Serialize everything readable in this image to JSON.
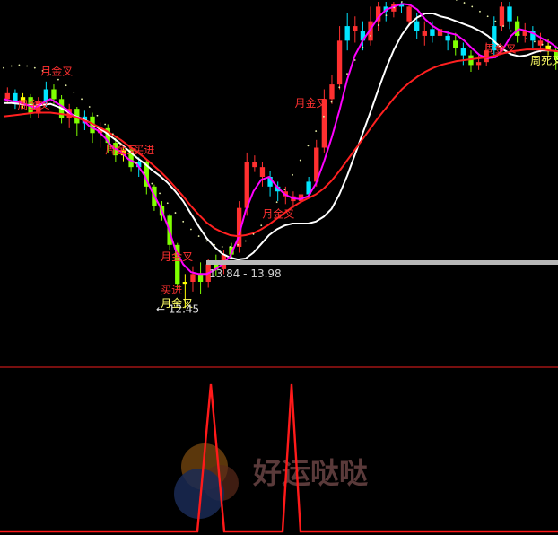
{
  "chart_data": [
    {
      "type": "candlestick",
      "panel": "price",
      "title": "",
      "xlabel": "",
      "ylabel": "",
      "ylim": [
        12.0,
        15.6
      ],
      "grid": false,
      "legend": "none",
      "candles": [
        {
          "o": 14.6,
          "c": 14.66,
          "h": 14.72,
          "l": 14.55,
          "col": "#ff3030"
        },
        {
          "o": 14.66,
          "c": 14.55,
          "h": 14.7,
          "l": 14.5,
          "col": "#00e5ff"
        },
        {
          "o": 14.55,
          "c": 14.62,
          "h": 14.66,
          "l": 14.5,
          "col": "#ffff00"
        },
        {
          "o": 14.62,
          "c": 14.45,
          "h": 14.65,
          "l": 14.4,
          "col": "#7fff00"
        },
        {
          "o": 14.45,
          "c": 14.58,
          "h": 14.62,
          "l": 14.4,
          "col": "#ff3030"
        },
        {
          "o": 14.58,
          "c": 14.7,
          "h": 14.78,
          "l": 14.52,
          "col": "#00e5ff"
        },
        {
          "o": 14.7,
          "c": 14.6,
          "h": 14.75,
          "l": 14.55,
          "col": "#7fff00"
        },
        {
          "o": 14.6,
          "c": 14.4,
          "h": 14.64,
          "l": 14.35,
          "col": "#7fff00"
        },
        {
          "o": 14.4,
          "c": 14.5,
          "h": 14.55,
          "l": 14.3,
          "col": "#ff3030"
        },
        {
          "o": 14.5,
          "c": 14.35,
          "h": 14.52,
          "l": 14.22,
          "col": "#7fff00"
        },
        {
          "o": 14.35,
          "c": 14.42,
          "h": 14.48,
          "l": 14.28,
          "col": "#00e5ff"
        },
        {
          "o": 14.42,
          "c": 14.25,
          "h": 14.46,
          "l": 14.15,
          "col": "#7fff00"
        },
        {
          "o": 14.25,
          "c": 14.3,
          "h": 14.36,
          "l": 14.1,
          "col": "#ff3030"
        },
        {
          "o": 14.3,
          "c": 14.15,
          "h": 14.34,
          "l": 14.05,
          "col": "#7fff00"
        },
        {
          "o": 14.15,
          "c": 14.02,
          "h": 14.2,
          "l": 13.95,
          "col": "#7fff00"
        },
        {
          "o": 14.02,
          "c": 14.08,
          "h": 14.12,
          "l": 13.96,
          "col": "#ffff00"
        },
        {
          "o": 14.08,
          "c": 13.9,
          "h": 14.1,
          "l": 13.85,
          "col": "#7fff00"
        },
        {
          "o": 13.9,
          "c": 13.95,
          "h": 14.0,
          "l": 13.8,
          "col": "#00e5ff"
        },
        {
          "o": 13.95,
          "c": 13.7,
          "h": 13.98,
          "l": 13.62,
          "col": "#7fff00"
        },
        {
          "o": 13.7,
          "c": 13.5,
          "h": 13.72,
          "l": 13.45,
          "col": "#7fff00"
        },
        {
          "o": 13.5,
          "c": 13.4,
          "h": 13.55,
          "l": 13.35,
          "col": "#7fff00"
        },
        {
          "o": 13.4,
          "c": 13.1,
          "h": 13.42,
          "l": 13.05,
          "col": "#7fff00"
        },
        {
          "o": 13.1,
          "c": 12.7,
          "h": 13.12,
          "l": 12.65,
          "col": "#7fff00"
        },
        {
          "o": 12.7,
          "c": 12.72,
          "h": 12.8,
          "l": 12.45,
          "col": "#ffff00"
        },
        {
          "o": 12.72,
          "c": 12.8,
          "h": 12.88,
          "l": 12.62,
          "col": "#ff3030"
        },
        {
          "o": 12.8,
          "c": 12.72,
          "h": 12.92,
          "l": 12.6,
          "col": "#7fff00"
        },
        {
          "o": 12.72,
          "c": 12.9,
          "h": 12.96,
          "l": 12.66,
          "col": "#ff3030"
        },
        {
          "o": 12.9,
          "c": 12.85,
          "h": 13.0,
          "l": 12.78,
          "col": "#7fff00"
        },
        {
          "o": 12.85,
          "c": 13.0,
          "h": 13.05,
          "l": 12.8,
          "col": "#ff3030"
        },
        {
          "o": 13.0,
          "c": 13.08,
          "h": 13.12,
          "l": 12.95,
          "col": "#7fff00"
        },
        {
          "o": 13.08,
          "c": 13.48,
          "h": 13.55,
          "l": 13.02,
          "col": "#ff3030"
        },
        {
          "o": 13.48,
          "c": 13.95,
          "h": 14.05,
          "l": 13.4,
          "col": "#ff3030"
        },
        {
          "o": 13.95,
          "c": 13.9,
          "h": 14.02,
          "l": 13.85,
          "col": "#ff3030"
        },
        {
          "o": 13.9,
          "c": 13.8,
          "h": 13.95,
          "l": 13.7,
          "col": "#ff3030"
        },
        {
          "o": 13.8,
          "c": 13.7,
          "h": 13.86,
          "l": 13.6,
          "col": "#00e5ff"
        },
        {
          "o": 13.7,
          "c": 13.65,
          "h": 13.75,
          "l": 13.55,
          "col": "#00e5ff"
        },
        {
          "o": 13.65,
          "c": 13.6,
          "h": 13.7,
          "l": 13.52,
          "col": "#ff3030"
        },
        {
          "o": 13.6,
          "c": 13.55,
          "h": 13.65,
          "l": 13.48,
          "col": "#ff3030"
        },
        {
          "o": 13.55,
          "c": 13.62,
          "h": 13.7,
          "l": 13.5,
          "col": "#ff3030"
        },
        {
          "o": 13.62,
          "c": 13.75,
          "h": 13.8,
          "l": 13.58,
          "col": "#00e5ff"
        },
        {
          "o": 13.75,
          "c": 14.1,
          "h": 14.18,
          "l": 13.7,
          "col": "#ff3030"
        },
        {
          "o": 14.1,
          "c": 14.6,
          "h": 14.7,
          "l": 14.05,
          "col": "#ff3030"
        },
        {
          "o": 14.6,
          "c": 14.75,
          "h": 14.85,
          "l": 14.55,
          "col": "#ff3030"
        },
        {
          "o": 14.75,
          "c": 15.2,
          "h": 15.35,
          "l": 14.7,
          "col": "#ff3030"
        },
        {
          "o": 15.2,
          "c": 15.35,
          "h": 15.48,
          "l": 15.1,
          "col": "#00e5ff"
        },
        {
          "o": 15.35,
          "c": 15.3,
          "h": 15.45,
          "l": 15.18,
          "col": "#ff3030"
        },
        {
          "o": 15.3,
          "c": 15.2,
          "h": 15.4,
          "l": 15.1,
          "col": "#00e5ff"
        },
        {
          "o": 15.2,
          "c": 15.4,
          "h": 15.55,
          "l": 15.15,
          "col": "#ff3030"
        },
        {
          "o": 15.4,
          "c": 15.55,
          "h": 15.6,
          "l": 15.3,
          "col": "#ff3030"
        },
        {
          "o": 15.55,
          "c": 15.5,
          "h": 15.6,
          "l": 15.4,
          "col": "#00e5ff"
        },
        {
          "o": 15.5,
          "c": 15.58,
          "h": 15.6,
          "l": 15.44,
          "col": "#ff3030"
        },
        {
          "o": 15.58,
          "c": 15.55,
          "h": 15.6,
          "l": 15.48,
          "col": "#00e5ff"
        },
        {
          "o": 15.55,
          "c": 15.4,
          "h": 15.58,
          "l": 15.35,
          "col": "#ff3030"
        },
        {
          "o": 15.4,
          "c": 15.3,
          "h": 15.48,
          "l": 15.22,
          "col": "#00e5ff"
        },
        {
          "o": 15.3,
          "c": 15.25,
          "h": 15.4,
          "l": 15.15,
          "col": "#ff3030"
        },
        {
          "o": 15.25,
          "c": 15.32,
          "h": 15.4,
          "l": 15.18,
          "col": "#00e5ff"
        },
        {
          "o": 15.32,
          "c": 15.25,
          "h": 15.38,
          "l": 15.15,
          "col": "#ff3030"
        },
        {
          "o": 15.25,
          "c": 15.2,
          "h": 15.3,
          "l": 15.1,
          "col": "#00e5ff"
        },
        {
          "o": 15.2,
          "c": 15.12,
          "h": 15.28,
          "l": 15.05,
          "col": "#7fff00"
        },
        {
          "o": 15.12,
          "c": 15.05,
          "h": 15.18,
          "l": 14.95,
          "col": "#00e5ff"
        },
        {
          "o": 15.05,
          "c": 14.95,
          "h": 15.1,
          "l": 14.88,
          "col": "#7fff00"
        },
        {
          "o": 14.95,
          "c": 14.98,
          "h": 15.05,
          "l": 14.9,
          "col": "#ff3030"
        },
        {
          "o": 14.98,
          "c": 15.1,
          "h": 15.18,
          "l": 14.94,
          "col": "#ff3030"
        },
        {
          "o": 15.1,
          "c": 15.35,
          "h": 15.45,
          "l": 15.05,
          "col": "#00e5ff"
        },
        {
          "o": 15.35,
          "c": 15.55,
          "h": 15.6,
          "l": 15.3,
          "col": "#ff3030"
        },
        {
          "o": 15.55,
          "c": 15.4,
          "h": 15.6,
          "l": 15.32,
          "col": "#00e5ff"
        },
        {
          "o": 15.4,
          "c": 15.25,
          "h": 15.45,
          "l": 15.18,
          "col": "#7fff00"
        },
        {
          "o": 15.25,
          "c": 15.3,
          "h": 15.38,
          "l": 15.18,
          "col": "#ff3030"
        },
        {
          "o": 15.3,
          "c": 15.2,
          "h": 15.35,
          "l": 15.12,
          "col": "#00e5ff"
        },
        {
          "o": 15.2,
          "c": 15.15,
          "h": 15.28,
          "l": 15.08,
          "col": "#ff3030"
        },
        {
          "o": 15.15,
          "c": 15.1,
          "h": 15.22,
          "l": 15.05,
          "col": "#ffff00"
        },
        {
          "o": 15.1,
          "c": 15.0,
          "h": 15.15,
          "l": 14.9,
          "col": "#7fff00"
        }
      ],
      "series": [
        {
          "type": "line",
          "color": "#ffffff",
          "values": [
            14.56,
            14.56,
            14.55,
            14.54,
            14.53,
            14.54,
            14.55,
            14.52,
            14.48,
            14.43,
            14.4,
            14.36,
            14.31,
            14.26,
            14.2,
            14.14,
            14.07,
            14.0,
            13.94,
            13.87,
            13.81,
            13.74,
            13.65,
            13.55,
            13.42,
            13.29,
            13.17,
            13.08,
            13.01,
            12.97,
            12.95,
            12.96,
            13.02,
            13.11,
            13.2,
            13.26,
            13.3,
            13.32,
            13.32,
            13.32,
            13.34,
            13.39,
            13.47,
            13.62,
            13.81,
            14.03,
            14.25,
            14.47,
            14.7,
            14.92,
            15.11,
            15.26,
            15.37,
            15.44,
            15.48,
            15.48,
            15.45,
            15.43,
            15.4,
            15.37,
            15.34,
            15.3,
            15.25,
            15.18,
            15.11,
            15.06,
            15.04,
            15.05,
            15.08,
            15.1,
            15.1,
            15.09
          ]
        },
        {
          "type": "line",
          "color": "#ff00ff",
          "values": [
            14.6,
            14.58,
            14.57,
            14.54,
            14.51,
            14.56,
            14.6,
            14.55,
            14.5,
            14.42,
            14.4,
            14.32,
            14.28,
            14.2,
            14.1,
            14.06,
            13.98,
            13.94,
            13.82,
            13.65,
            13.5,
            13.3,
            13.05,
            12.9,
            12.82,
            12.8,
            12.8,
            12.84,
            12.9,
            12.98,
            13.16,
            13.45,
            13.65,
            13.77,
            13.8,
            13.7,
            13.62,
            13.58,
            13.57,
            13.6,
            13.73,
            13.95,
            14.2,
            14.48,
            14.8,
            15.05,
            15.2,
            15.32,
            15.44,
            15.52,
            15.55,
            15.58,
            15.57,
            15.52,
            15.42,
            15.35,
            15.3,
            15.28,
            15.26,
            15.2,
            15.12,
            15.05,
            15.02,
            15.03,
            15.12,
            15.25,
            15.32,
            15.3,
            15.27,
            15.22,
            15.18,
            15.12
          ]
        },
        {
          "type": "line",
          "color": "#ff2020",
          "values": [
            14.42,
            14.43,
            14.44,
            14.45,
            14.46,
            14.46,
            14.46,
            14.45,
            14.44,
            14.42,
            14.39,
            14.36,
            14.32,
            14.28,
            14.23,
            14.18,
            14.12,
            14.06,
            14.0,
            13.93,
            13.86,
            13.78,
            13.69,
            13.6,
            13.5,
            13.41,
            13.33,
            13.27,
            13.23,
            13.2,
            13.19,
            13.2,
            13.22,
            13.26,
            13.31,
            13.37,
            13.43,
            13.49,
            13.54,
            13.58,
            13.62,
            13.68,
            13.76,
            13.86,
            13.97,
            14.08,
            14.19,
            14.3,
            14.41,
            14.51,
            14.61,
            14.7,
            14.77,
            14.83,
            14.88,
            14.92,
            14.95,
            14.97,
            14.99,
            15.0,
            15.01,
            15.02,
            15.03,
            15.05,
            15.07,
            15.09,
            15.1,
            15.11,
            15.11,
            15.11,
            15.1,
            15.09
          ]
        },
        {
          "type": "dotted",
          "color": "#e8f0a8",
          "values": [
            14.92,
            14.94,
            14.95,
            14.94,
            14.92,
            14.89,
            14.85,
            14.8,
            14.74,
            14.67,
            14.6,
            14.52,
            14.43,
            14.34,
            14.24,
            14.14,
            14.04,
            13.94,
            13.84,
            13.73,
            13.63,
            13.53,
            13.43,
            13.34,
            13.26,
            13.19,
            13.14,
            13.1,
            13.08,
            13.08,
            13.1,
            13.14,
            13.21,
            13.3,
            13.41,
            13.54,
            13.67,
            13.82,
            13.97,
            14.12,
            14.27,
            14.42,
            14.57,
            14.72,
            14.86,
            15.0,
            15.13,
            15.25,
            15.36,
            15.46,
            15.54,
            15.6,
            15.64,
            15.67,
            15.68,
            15.68,
            15.67,
            15.65,
            15.62,
            15.59,
            15.55,
            15.5,
            15.45,
            15.4,
            15.35,
            15.3,
            15.26,
            15.22,
            15.19,
            15.16,
            15.14,
            15.12
          ]
        }
      ],
      "price_line": {
        "value": 13.9,
        "label": "13.84 - 13.98"
      },
      "annotations": [
        {
          "text": "月金叉",
          "i": 8,
          "y": 14.85,
          "color": "#ff3030"
        },
        {
          "text": "周金叉",
          "i": 3,
          "y": 14.5,
          "color": "#ff3030"
        },
        {
          "text": "周金叉",
          "i": 22,
          "y": 14.04,
          "color": "#ff3030"
        },
        {
          "text": "买进",
          "i": 28,
          "y": 14.04,
          "color": "#ff3030"
        },
        {
          "text": "月金叉",
          "i": 63,
          "y": 14.52,
          "color": "#ff3030"
        },
        {
          "text": "月金叉",
          "i": 56,
          "y": 13.38,
          "color": "#ff3030"
        },
        {
          "text": "月金叉",
          "i": 34,
          "y": 12.94,
          "color": "#ff3030"
        },
        {
          "text": "买进",
          "i": 34,
          "y": 12.6,
          "color": "#ff3030"
        },
        {
          "text": "月金叉",
          "i": 34,
          "y": 12.46,
          "color": "#ffff66"
        },
        {
          "text": "周金叉",
          "i": 104,
          "y": 15.08,
          "color": "#ff3030"
        },
        {
          "text": "周死叉",
          "i": 114,
          "y": 14.96,
          "color": "#ffff66"
        }
      ],
      "low_label": {
        "text": "← 12.45",
        "i": 33,
        "y": 12.4
      }
    },
    {
      "type": "line",
      "panel": "signal",
      "title": "",
      "xlabel": "",
      "ylabel": "",
      "ylim": [
        0,
        1
      ],
      "grid": false,
      "legend": "none",
      "series": [
        {
          "color": "#ff1a1a",
          "x": [
            0,
            44,
            47,
            50,
            63,
            65,
            67,
            622
          ],
          "values": [
            0,
            0,
            1,
            0,
            0,
            1,
            0,
            0
          ]
        }
      ]
    }
  ],
  "watermark": {
    "text": "好运哒哒"
  }
}
